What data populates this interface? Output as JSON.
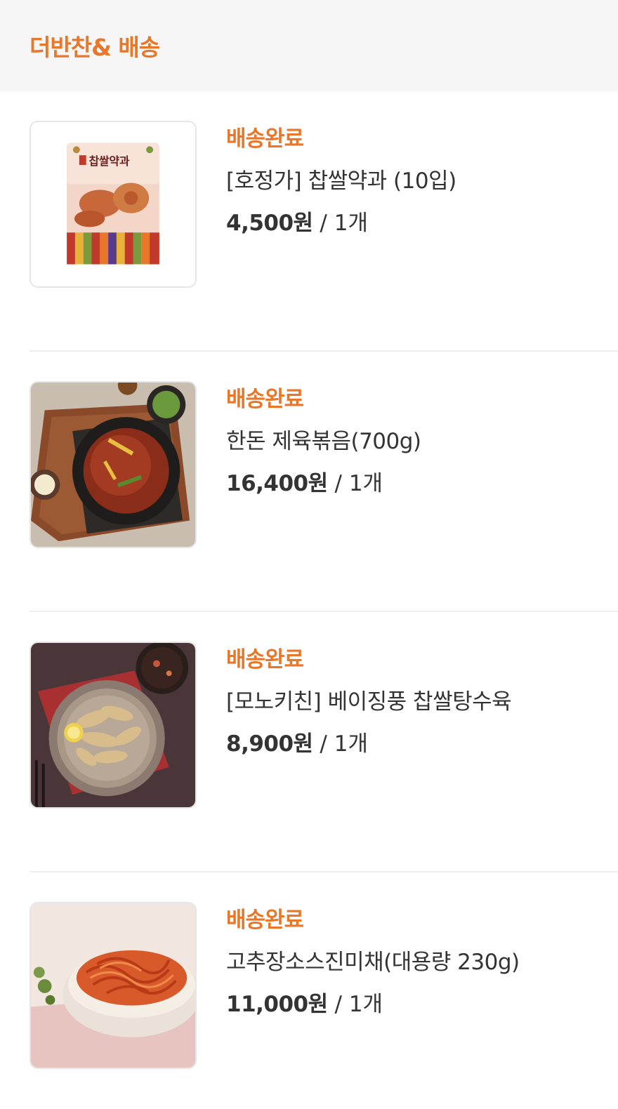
{
  "header": {
    "title": "더반찬& 배송"
  },
  "colors": {
    "accent": "#e8772a",
    "text": "#333333",
    "header_bg": "#f6f6f6",
    "divider": "#eeeeee"
  },
  "orders": [
    {
      "status": "배송완료",
      "name": "[호정가] 찹쌀약과 (10입)",
      "price": "4,500원",
      "separator": " / ",
      "quantity": "1개",
      "thumb_label": "찹쌀약과"
    },
    {
      "status": "배송완료",
      "name": "한돈 제육볶음(700g)",
      "price": "16,400원",
      "separator": " / ",
      "quantity": "1개"
    },
    {
      "status": "배송완료",
      "name": "[모노키친] 베이징풍 찹쌀탕수육",
      "price": "8,900원",
      "separator": " / ",
      "quantity": "1개"
    },
    {
      "status": "배송완료",
      "name": "고추장소스진미채(대용량 230g)",
      "price": "11,000원",
      "separator": " / ",
      "quantity": "1개"
    }
  ]
}
